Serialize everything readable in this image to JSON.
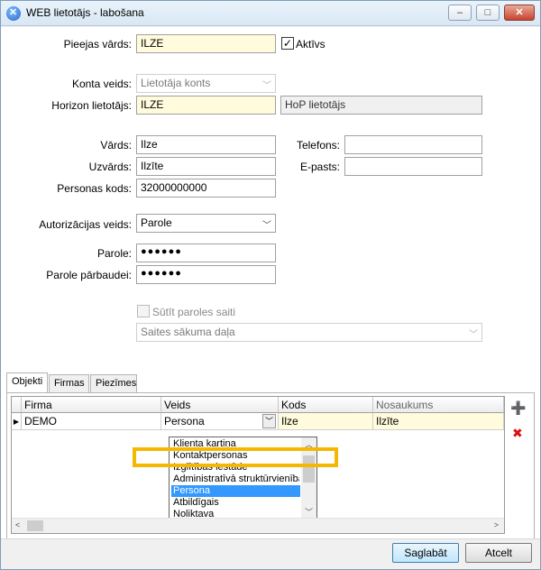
{
  "window": {
    "title": "WEB lietotājs - labošana",
    "minimize": "‒",
    "maximize": "□",
    "close": "✕"
  },
  "form": {
    "pieejas_vards": {
      "label": "Pieejas vārds:",
      "value": "ILZE"
    },
    "aktivs": {
      "label": "Aktīvs",
      "checked": "✓"
    },
    "konta_veids": {
      "label": "Konta veids:",
      "value": "Lietotāja konts"
    },
    "horizon_lietotajs": {
      "label": "Horizon lietotājs:",
      "value": "ILZE",
      "role": "HoP lietotājs"
    },
    "vards": {
      "label": "Vārds:",
      "value": "Ilze"
    },
    "uzvards": {
      "label": "Uzvārds:",
      "value": "Ilzīte"
    },
    "personas_kods": {
      "label": "Personas kods:",
      "value": "32000000000"
    },
    "telefons": {
      "label": "Telefons:",
      "value": ""
    },
    "e_pasts": {
      "label": "E-pasts:",
      "value": ""
    },
    "autorizacijas_veids": {
      "label": "Autorizācijas veids:",
      "value": "Parole"
    },
    "parole": {
      "label": "Parole:",
      "value": "●●●●●●"
    },
    "parole_parbaude": {
      "label": "Parole pārbaudei:",
      "value": "●●●●●●"
    },
    "sutit_saiti": {
      "label": "Sūtīt paroles saiti"
    },
    "saites_lapa": {
      "placeholder": "Saites sākuma daļa"
    }
  },
  "tabs": [
    "Objekti",
    "Firmas",
    "Piezīmes"
  ],
  "grid": {
    "headers": [
      "Firma",
      "Veids",
      "Kods",
      "Nosaukums"
    ],
    "row": {
      "indicator": "▶",
      "firma": "DEMO",
      "veids": "Persona",
      "kods": "Ilze",
      "nosaukums": "Ilzīte"
    },
    "dropdown": [
      "Klienta kartiņa",
      "Kontaktpersonas",
      "Izglītības iestāde",
      "Administratīvā struktūrvienība",
      "Persona",
      "Atbildīgais",
      "Noliktava"
    ],
    "selected": "Persona"
  },
  "side": {
    "add": "➕",
    "delete": "✖"
  },
  "buttons": {
    "save": "Saglabāt",
    "cancel": "Atcelt"
  },
  "colors": {
    "highlight": "#f5b800",
    "selection": "#3399ff",
    "field_yellow": "#fffbdc"
  }
}
